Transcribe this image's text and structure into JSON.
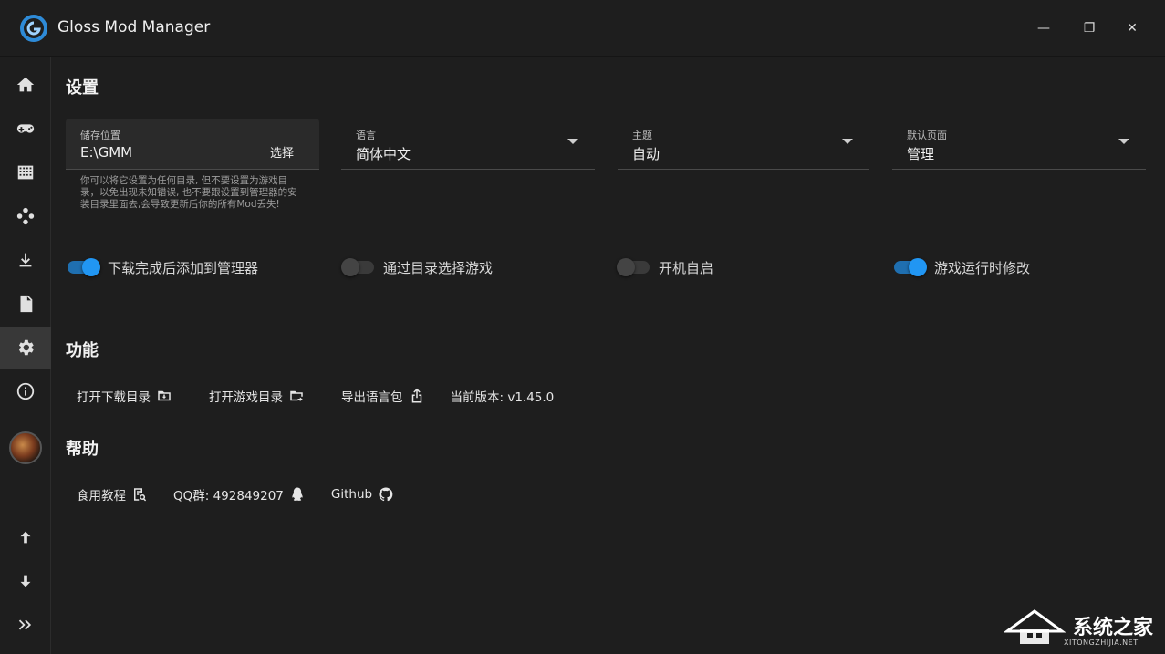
{
  "window": {
    "title": "Gloss Mod Manager",
    "minimize": "—",
    "maximize": "❐",
    "close": "✕"
  },
  "sidebar": {
    "items": [
      {
        "icon": "home-icon"
      },
      {
        "icon": "gamepad-icon"
      },
      {
        "icon": "grid-icon"
      },
      {
        "icon": "hub-icon"
      },
      {
        "icon": "download-icon"
      },
      {
        "icon": "document-star-icon"
      },
      {
        "icon": "settings-icon",
        "active": true
      },
      {
        "icon": "info-icon"
      }
    ],
    "bottom": [
      {
        "icon": "arrow-up-icon"
      },
      {
        "icon": "arrow-down-icon"
      },
      {
        "icon": "double-chevron-right-icon"
      }
    ]
  },
  "settings": {
    "title": "设置",
    "storage": {
      "label": "储存位置",
      "value": "E:\\GMM",
      "button": "选择",
      "hint": "你可以将它设置为任何目录, 但不要设置为游戏目录，以免出现未知错误, 也不要跟设置到管理器的安装目录里面去,会导致更新后你的所有Mod丢失!"
    },
    "language": {
      "label": "语言",
      "value": "简体中文"
    },
    "theme": {
      "label": "主题",
      "value": "自动"
    },
    "default_page": {
      "label": "默认页面",
      "value": "管理"
    },
    "switches": [
      {
        "label": "下载完成后添加到管理器",
        "on": true
      },
      {
        "label": "通过目录选择游戏",
        "on": false
      },
      {
        "label": "开机自启",
        "on": false
      },
      {
        "label": "游戏运行时修改",
        "on": true
      }
    ]
  },
  "features": {
    "title": "功能",
    "open_download_dir": "打开下载目录",
    "open_game_dir": "打开游戏目录",
    "export_language": "导出语言包",
    "version": "当前版本: v1.45.0"
  },
  "help": {
    "title": "帮助",
    "tutorial": "食用教程",
    "qq_group": "QQ群: 492849207",
    "github": "Github"
  },
  "watermark": {
    "text": "系统之家",
    "sub": "XITONGZHIJIA.NET"
  },
  "colors": {
    "background": "#1e1e1e",
    "accent": "#2196f3",
    "active_nav": "#383838"
  }
}
